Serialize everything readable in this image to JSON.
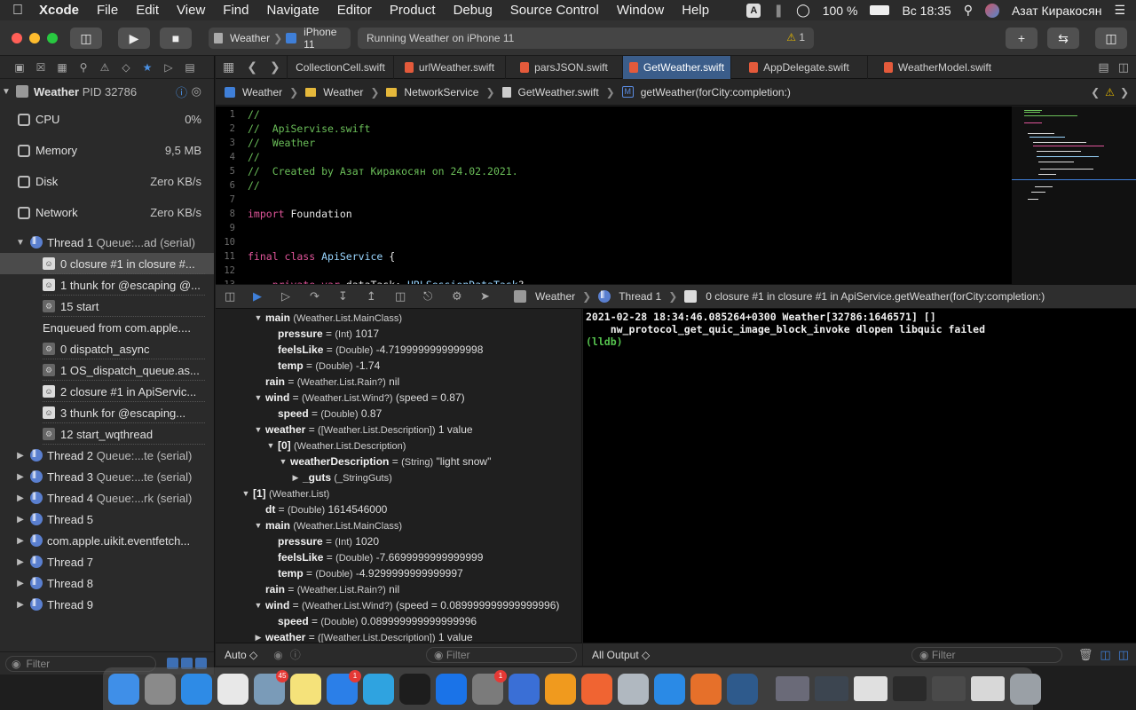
{
  "menubar": {
    "app": "Xcode",
    "items": [
      "File",
      "Edit",
      "View",
      "Find",
      "Navigate",
      "Editor",
      "Product",
      "Debug",
      "Source Control",
      "Window",
      "Help"
    ],
    "input_source": "A",
    "battery": "100 %",
    "clock": "Вс 18:35",
    "user": "Азат Киракосян"
  },
  "toolbar": {
    "scheme": "Weather",
    "device": "iPhone 11",
    "status": "Running Weather on iPhone 11",
    "warning_count": "1"
  },
  "navigator": {
    "process": "Weather",
    "pid": "PID 32786",
    "gauges": [
      {
        "name": "CPU",
        "value": "0%"
      },
      {
        "name": "Memory",
        "value": "9,5 MB"
      },
      {
        "name": "Disk",
        "value": "Zero KB/s"
      },
      {
        "name": "Network",
        "value": "Zero KB/s"
      }
    ],
    "thread1": "Thread 1",
    "thread1_queue": "Queue:...ad (serial)",
    "frames": [
      {
        "label": "0 closure #1 in closure #...",
        "kind": "user"
      },
      {
        "label": "1 thunk for @escaping @...",
        "kind": "user"
      },
      {
        "label": "15 start",
        "kind": "sys"
      }
    ],
    "enqueued": "Enqueued from com.apple....",
    "enq_frames": [
      {
        "label": "0 dispatch_async",
        "kind": "sys"
      },
      {
        "label": "1 OS_dispatch_queue.as...",
        "kind": "sys"
      },
      {
        "label": "2 closure #1 in ApiServic...",
        "kind": "user"
      },
      {
        "label": "3 thunk for @escaping...",
        "kind": "user"
      },
      {
        "label": "12 start_wqthread",
        "kind": "sys"
      }
    ],
    "threads": [
      {
        "name": "Thread 2",
        "queue": "Queue:...te (serial)"
      },
      {
        "name": "Thread 3",
        "queue": "Queue:...te (serial)"
      },
      {
        "name": "Thread 4",
        "queue": "Queue:...rk (serial)"
      },
      {
        "name": "Thread 5",
        "queue": ""
      },
      {
        "name": "com.apple.uikit.eventfetch...",
        "queue": ""
      },
      {
        "name": "Thread 7",
        "queue": ""
      },
      {
        "name": "Thread 8",
        "queue": ""
      },
      {
        "name": "Thread 9",
        "queue": ""
      }
    ],
    "filter_placeholder": "Filter"
  },
  "tabs": [
    "CollectionCell.swift",
    "urlWeather.swift",
    "parsJSON.swift",
    "GetWeather.swift",
    "AppDelegate.swift",
    "WeatherModel.swift"
  ],
  "active_tab": "GetWeather.swift",
  "jumpbar": [
    "Weather",
    "Weather",
    "NetworkService",
    "GetWeather.swift",
    "getWeather(forCity:completion:)"
  ],
  "code": [
    {
      "n": "1",
      "parts": [
        [
          "com",
          "//"
        ]
      ]
    },
    {
      "n": "2",
      "parts": [
        [
          "com",
          "//  ApiServise.swift"
        ]
      ]
    },
    {
      "n": "3",
      "parts": [
        [
          "com",
          "//  Weather"
        ]
      ]
    },
    {
      "n": "4",
      "parts": [
        [
          "com",
          "//"
        ]
      ]
    },
    {
      "n": "5",
      "parts": [
        [
          "com",
          "//  Created by Азат Киракосян on 24.02.2021."
        ]
      ]
    },
    {
      "n": "6",
      "parts": [
        [
          "com",
          "//"
        ]
      ]
    },
    {
      "n": "7",
      "parts": []
    },
    {
      "n": "8",
      "parts": [
        [
          "kw",
          "import"
        ],
        [
          "txt",
          " Foundation"
        ]
      ]
    },
    {
      "n": "9",
      "parts": []
    },
    {
      "n": "10",
      "parts": []
    },
    {
      "n": "11",
      "parts": [
        [
          "kw",
          "final class"
        ],
        [
          "txt",
          " "
        ],
        [
          "type",
          "ApiService"
        ],
        [
          "txt",
          " {"
        ]
      ]
    },
    {
      "n": "12",
      "parts": []
    },
    {
      "n": "13",
      "parts": [
        [
          "txt",
          "    "
        ],
        [
          "kw",
          "private var"
        ],
        [
          "txt",
          " dataTask: "
        ],
        [
          "type",
          "URLSessionDataTask"
        ],
        [
          "txt",
          "?"
        ]
      ]
    }
  ],
  "debugbar": {
    "crumbs": [
      "Weather",
      "Thread 1",
      "0 closure #1 in closure #1 in ApiService.getWeather(forCity:completion:)"
    ]
  },
  "variables": [
    {
      "indent": 3,
      "tri": "▼",
      "name": "main",
      "type": "(Weather.List.MainClass)",
      "rest": ""
    },
    {
      "indent": 4,
      "tri": "",
      "name": "pressure",
      "type": "(Int)",
      "rest": "1017"
    },
    {
      "indent": 4,
      "tri": "",
      "name": "feelsLike",
      "type": "(Double)",
      "rest": "-4.7199999999999998"
    },
    {
      "indent": 4,
      "tri": "",
      "name": "temp",
      "type": "(Double)",
      "rest": "-1.74"
    },
    {
      "indent": 3,
      "tri": "",
      "name": "rain",
      "type": "(Weather.List.Rain?)",
      "rest": "nil"
    },
    {
      "indent": 3,
      "tri": "▼",
      "name": "wind",
      "type": "(Weather.List.Wind?)",
      "rest": "(speed = 0.87)"
    },
    {
      "indent": 4,
      "tri": "",
      "name": "speed",
      "type": "(Double)",
      "rest": "0.87"
    },
    {
      "indent": 3,
      "tri": "▼",
      "name": "weather",
      "type": "([Weather.List.Description])",
      "rest": "1 value"
    },
    {
      "indent": 4,
      "tri": "▼",
      "name": "[0]",
      "type": "(Weather.List.Description)",
      "rest": ""
    },
    {
      "indent": 5,
      "tri": "▼",
      "name": "weatherDescription",
      "type": "(String)",
      "rest": "\"light snow\""
    },
    {
      "indent": 6,
      "tri": "▶",
      "name": "_guts",
      "type": "(_StringGuts)",
      "rest": ""
    },
    {
      "indent": 2,
      "tri": "▼",
      "name": "[1]",
      "type": "(Weather.List)",
      "rest": ""
    },
    {
      "indent": 3,
      "tri": "",
      "name": "dt",
      "type": "(Double)",
      "rest": "1614546000"
    },
    {
      "indent": 3,
      "tri": "▼",
      "name": "main",
      "type": "(Weather.List.MainClass)",
      "rest": ""
    },
    {
      "indent": 4,
      "tri": "",
      "name": "pressure",
      "type": "(Int)",
      "rest": "1020"
    },
    {
      "indent": 4,
      "tri": "",
      "name": "feelsLike",
      "type": "(Double)",
      "rest": "-7.6699999999999999"
    },
    {
      "indent": 4,
      "tri": "",
      "name": "temp",
      "type": "(Double)",
      "rest": "-4.9299999999999997"
    },
    {
      "indent": 3,
      "tri": "",
      "name": "rain",
      "type": "(Weather.List.Rain?)",
      "rest": "nil"
    },
    {
      "indent": 3,
      "tri": "▼",
      "name": "wind",
      "type": "(Weather.List.Wind?)",
      "rest": "(speed = 0.089999999999999996)"
    },
    {
      "indent": 4,
      "tri": "",
      "name": "speed",
      "type": "(Double)",
      "rest": "0.089999999999999996"
    },
    {
      "indent": 3,
      "tri": "▶",
      "name": "weather",
      "type": "([Weather.List.Description])",
      "rest": "1 value"
    }
  ],
  "console": [
    "2021-02-28 18:34:46.085264+0300 Weather[32786:1646571] []",
    "    nw_protocol_get_quic_image_block_invoke dlopen libquic failed"
  ],
  "console_prompt": "(lldb)",
  "vars_bottom": {
    "scope": "Auto ◇",
    "filter": "Filter"
  },
  "console_bottom": {
    "output": "All Output ◇",
    "filter": "Filter"
  },
  "dock": {
    "apps": [
      {
        "name": "Finder",
        "color": "#3f8fe8",
        "badge": ""
      },
      {
        "name": "Launchpad",
        "color": "#8a8a8a",
        "badge": ""
      },
      {
        "name": "Safari",
        "color": "#2e8be6",
        "badge": ""
      },
      {
        "name": "Chrome",
        "color": "#e8e8e8",
        "badge": ""
      },
      {
        "name": "Preview",
        "color": "#7a9bb8",
        "badge": "45"
      },
      {
        "name": "Notes",
        "color": "#f5e27a",
        "badge": ""
      },
      {
        "name": "App Store",
        "color": "#2b7fe8",
        "badge": "1"
      },
      {
        "name": "Telegram",
        "color": "#2fa3e0",
        "badge": ""
      },
      {
        "name": "Terminal",
        "color": "#1d1d1d",
        "badge": ""
      },
      {
        "name": "Maps",
        "color": "#1a73e8",
        "badge": ""
      },
      {
        "name": "System Preferences",
        "color": "#7b7b7b",
        "badge": "1"
      },
      {
        "name": "Instruments",
        "color": "#3a6fd6",
        "badge": ""
      },
      {
        "name": "Sublime Text",
        "color": "#f09a1e",
        "badge": ""
      },
      {
        "name": "Swift Playgrounds",
        "color": "#f06432",
        "badge": ""
      },
      {
        "name": "Image Capture",
        "color": "#b0b8c0",
        "badge": ""
      },
      {
        "name": "Xcode",
        "color": "#2a8ae6",
        "badge": ""
      },
      {
        "name": "Rocket",
        "color": "#e6702a",
        "badge": ""
      },
      {
        "name": "QuickTime",
        "color": "#2e5a8c",
        "badge": ""
      },
      {
        "name": "Window thumb 1",
        "color": "#6a6a78",
        "badge": ""
      },
      {
        "name": "Window thumb 2",
        "color": "#3c4550",
        "badge": ""
      },
      {
        "name": "Window thumb 3",
        "color": "#e0e0e0",
        "badge": ""
      },
      {
        "name": "Window thumb 4",
        "color": "#2a2a2a",
        "badge": ""
      },
      {
        "name": "Window thumb 5",
        "color": "#4a4a4a",
        "badge": ""
      },
      {
        "name": "Window thumb 6",
        "color": "#d8d8d8",
        "badge": ""
      },
      {
        "name": "Trash",
        "color": "#9aa0a6",
        "badge": ""
      }
    ]
  }
}
